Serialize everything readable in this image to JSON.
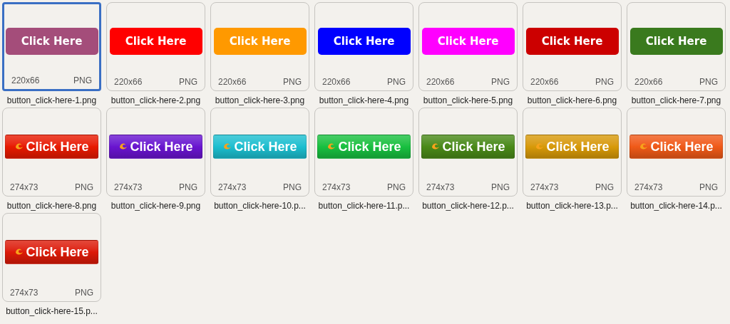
{
  "files": [
    {
      "filename": "button_click-here-1.png",
      "dimensions": "220x66",
      "type": "PNG",
      "selected": true,
      "preview": {
        "kind": "flat",
        "text": "Click Here",
        "color": "#a44d7a"
      }
    },
    {
      "filename": "button_click-here-2.png",
      "dimensions": "220x66",
      "type": "PNG",
      "selected": false,
      "preview": {
        "kind": "flat",
        "text": "Click Here",
        "color": "#ff0000"
      }
    },
    {
      "filename": "button_click-here-3.png",
      "dimensions": "220x66",
      "type": "PNG",
      "selected": false,
      "preview": {
        "kind": "flat",
        "text": "Click Here",
        "color": "#ff9900"
      }
    },
    {
      "filename": "button_click-here-4.png",
      "dimensions": "220x66",
      "type": "PNG",
      "selected": false,
      "preview": {
        "kind": "flat",
        "text": "Click Here",
        "color": "#0000ff"
      }
    },
    {
      "filename": "button_click-here-5.png",
      "dimensions": "220x66",
      "type": "PNG",
      "selected": false,
      "preview": {
        "kind": "flat",
        "text": "Click Here",
        "color": "#ff00ff"
      }
    },
    {
      "filename": "button_click-here-6.png",
      "dimensions": "220x66",
      "type": "PNG",
      "selected": false,
      "preview": {
        "kind": "flat",
        "text": "Click Here",
        "color": "#cc0000"
      }
    },
    {
      "filename": "button_click-here-7.png",
      "dimensions": "220x66",
      "type": "PNG",
      "selected": false,
      "preview": {
        "kind": "flat",
        "text": "Click Here",
        "color": "#3a7a1e"
      }
    },
    {
      "filename": "button_click-here-8.png",
      "dimensions": "274x73",
      "type": "PNG",
      "selected": false,
      "preview": {
        "kind": "glossy",
        "text": "Click Here",
        "color": "#e81a00"
      }
    },
    {
      "filename": "button_click-here-9.png",
      "dimensions": "274x73",
      "type": "PNG",
      "selected": false,
      "preview": {
        "kind": "glossy",
        "text": "Click Here",
        "color": "#6a14d0"
      }
    },
    {
      "filename": "button_click-here-10.p...",
      "dimensions": "274x73",
      "type": "PNG",
      "selected": false,
      "preview": {
        "kind": "glossy",
        "text": "Click Here",
        "color": "#1cbfd0"
      }
    },
    {
      "filename": "button_click-here-11.p...",
      "dimensions": "274x73",
      "type": "PNG",
      "selected": false,
      "preview": {
        "kind": "glossy",
        "text": "Click Here",
        "color": "#18c040"
      }
    },
    {
      "filename": "button_click-here-12.p...",
      "dimensions": "274x73",
      "type": "PNG",
      "selected": false,
      "preview": {
        "kind": "glossy",
        "text": "Click Here",
        "color": "#4a8a18"
      }
    },
    {
      "filename": "button_click-here-13.p...",
      "dimensions": "274x73",
      "type": "PNG",
      "selected": false,
      "preview": {
        "kind": "glossy",
        "text": "Click Here",
        "color": "#d89a08"
      }
    },
    {
      "filename": "button_click-here-14.p...",
      "dimensions": "274x73",
      "type": "PNG",
      "selected": false,
      "preview": {
        "kind": "glossy",
        "text": "Click Here",
        "color": "#f05a18"
      }
    },
    {
      "filename": "button_click-here-15.p...",
      "dimensions": "274x73",
      "type": "PNG",
      "selected": false,
      "preview": {
        "kind": "glossy",
        "text": "Click Here",
        "color": "#dd1a08"
      }
    }
  ]
}
